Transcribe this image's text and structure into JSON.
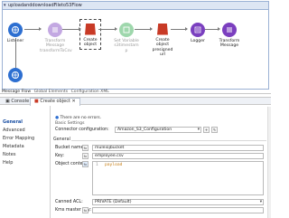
{
  "flow": {
    "title": "uploadanddownloadFileto53Flow",
    "nodes": [
      {
        "label": "Listener",
        "icon": "http-listener-icon",
        "color": "#2d6fd1",
        "dim": false
      },
      {
        "label": "Transform Message\ntransformToCsv",
        "icon": "transform-icon",
        "color": "#7b3fbf",
        "dim": true
      },
      {
        "label": "Create\nobject",
        "icon": "s3-bucket-icon",
        "color": "#c83a26",
        "dim": false
      },
      {
        "label": "Set Variable\ns3timestam\np",
        "icon": "set-variable-icon",
        "color": "#2aa84a",
        "dim": true
      },
      {
        "label": "Create\nobject\npresigned\nurl",
        "icon": "s3-bucket-icon",
        "color": "#c83a26",
        "dim": false
      },
      {
        "label": "Logger",
        "icon": "logger-icon",
        "color": "#7a3fbf",
        "dim": false
      },
      {
        "label": "Transform\nMessage",
        "icon": "transform-icon",
        "color": "#7b3fbf",
        "dim": false
      }
    ],
    "loop_node": {
      "icon": "http-listener-icon",
      "color": "#2d6fd1"
    },
    "canvas_tabs": [
      "Message Flow",
      "Global Elements",
      "Configuration XML"
    ]
  },
  "views": {
    "console": "Console",
    "create_object": "Create object"
  },
  "sidenav": [
    "General",
    "Advanced",
    "Error Mapping",
    "Metadata",
    "Notes",
    "Help"
  ],
  "panel": {
    "status": "There are no errors.",
    "basic_settings": "Basic Settings",
    "connector_config_label": "Connector configuration:",
    "connector_config_value": "Amazon_S3_Configuration",
    "general_group": "General",
    "bucket_label": "Bucket name:",
    "bucket_value": "muleiojbucket",
    "key_label": "Key:",
    "key_value": "employee.csv",
    "object_content_label": "Object content:",
    "code_line_no": "1",
    "code_text": "payload",
    "canned_acl_label": "Canned ACL:",
    "canned_acl_value": "PRIVATE (Default)",
    "kms_label": "Kms master key:"
  }
}
